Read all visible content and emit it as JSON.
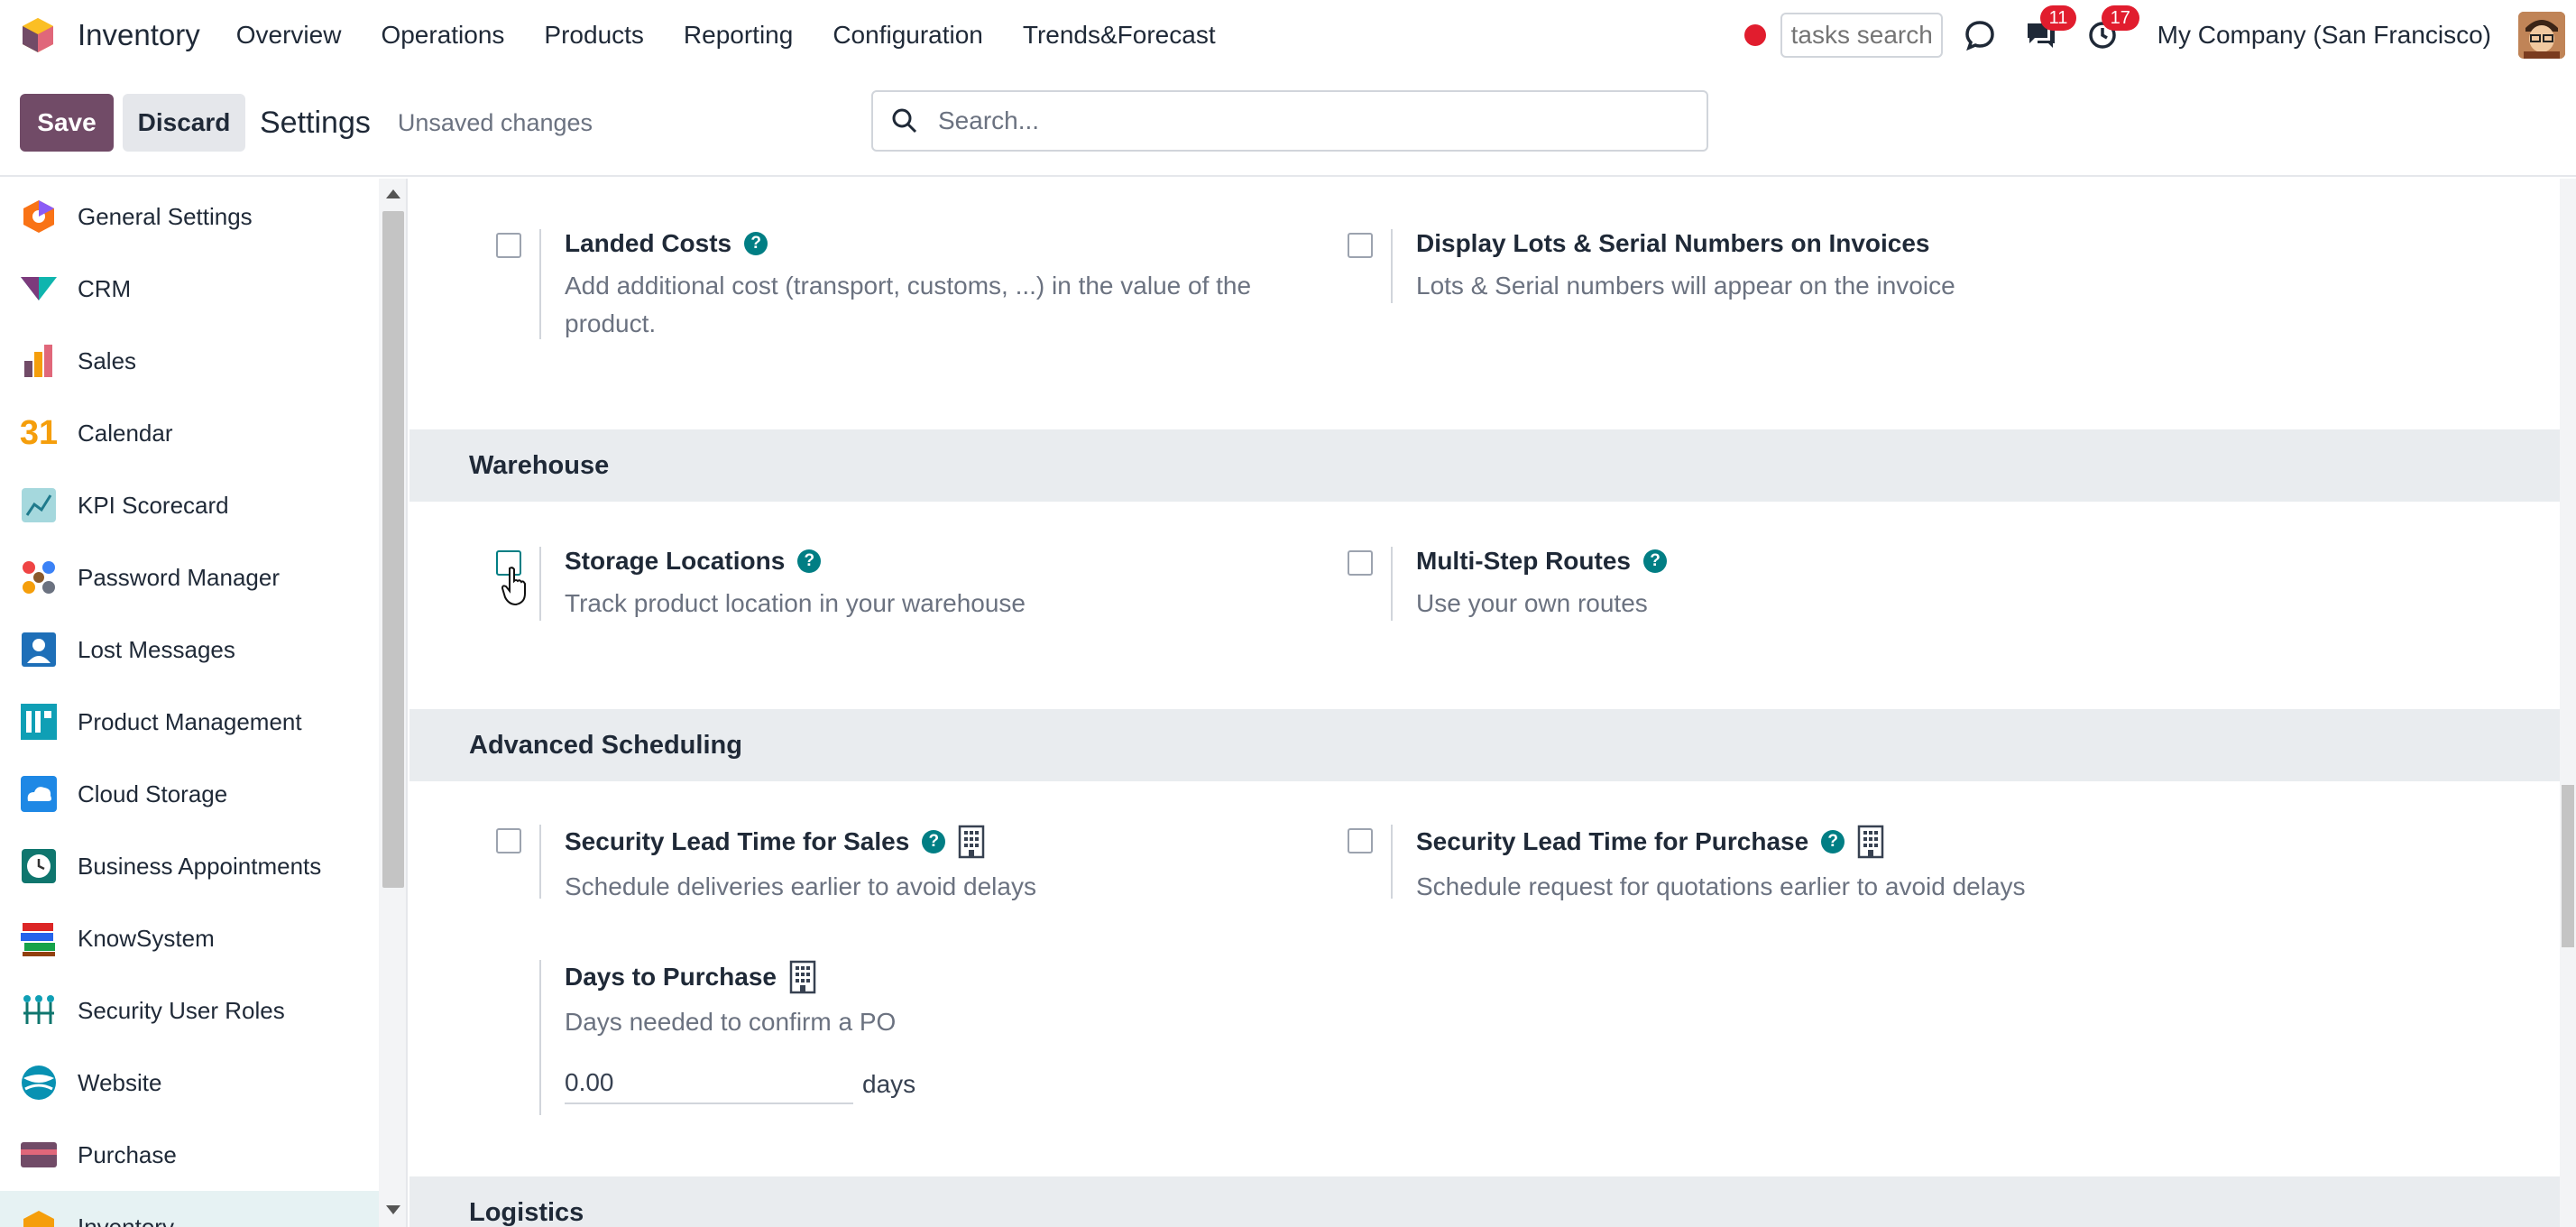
{
  "topbar": {
    "app_name": "Inventory",
    "menu": [
      "Overview",
      "Operations",
      "Products",
      "Reporting",
      "Configuration",
      "Trends&Forecast"
    ],
    "tasks_search_placeholder": "tasks search",
    "messages_count": "11",
    "activities_count": "17",
    "company": "My Company (San Francisco)"
  },
  "control": {
    "save_label": "Save",
    "discard_label": "Discard",
    "breadcrumb": "Settings",
    "status": "Unsaved changes",
    "search_placeholder": "Search..."
  },
  "sidebar": {
    "items": [
      {
        "label": "General Settings",
        "icon": "general-settings-icon"
      },
      {
        "label": "CRM",
        "icon": "crm-icon"
      },
      {
        "label": "Sales",
        "icon": "sales-icon"
      },
      {
        "label": "Calendar",
        "icon": "calendar-icon"
      },
      {
        "label": "KPI Scorecard",
        "icon": "kpi-icon"
      },
      {
        "label": "Password Manager",
        "icon": "password-icon"
      },
      {
        "label": "Lost Messages",
        "icon": "lost-messages-icon"
      },
      {
        "label": "Product Management",
        "icon": "product-management-icon"
      },
      {
        "label": "Cloud Storage",
        "icon": "cloud-icon"
      },
      {
        "label": "Business Appointments",
        "icon": "clock-icon"
      },
      {
        "label": "KnowSystem",
        "icon": "books-icon"
      },
      {
        "label": "Security User Roles",
        "icon": "roles-icon"
      },
      {
        "label": "Website",
        "icon": "website-icon"
      },
      {
        "label": "Purchase",
        "icon": "purchase-icon"
      },
      {
        "label": "Inventory",
        "icon": "inventory-icon"
      }
    ],
    "calendar_glyph": "31"
  },
  "sections": {
    "valuation": {
      "landed_costs": {
        "title": "Landed Costs",
        "desc": "Add additional cost (transport, customs, ...) in the value of the product."
      },
      "lots_invoices": {
        "title": "Display Lots & Serial Numbers on Invoices",
        "desc": "Lots & Serial numbers will appear on the invoice"
      }
    },
    "warehouse": {
      "heading": "Warehouse",
      "storage_locations": {
        "title": "Storage Locations",
        "desc": "Track product location in your warehouse"
      },
      "multi_step": {
        "title": "Multi-Step Routes",
        "desc": "Use your own routes"
      }
    },
    "scheduling": {
      "heading": "Advanced Scheduling",
      "lead_sales": {
        "title": "Security Lead Time for Sales",
        "desc": "Schedule deliveries earlier to avoid delays"
      },
      "lead_purchase": {
        "title": "Security Lead Time for Purchase",
        "desc": "Schedule request for quotations earlier to avoid delays"
      },
      "days_to_purchase": {
        "title": "Days to Purchase",
        "desc": "Days needed to confirm a PO",
        "value": "0.00",
        "unit": "days"
      }
    },
    "logistics": {
      "heading": "Logistics"
    }
  },
  "colors": {
    "brand": "#714b67",
    "accent": "#017e84",
    "badge": "#e11d2e"
  }
}
